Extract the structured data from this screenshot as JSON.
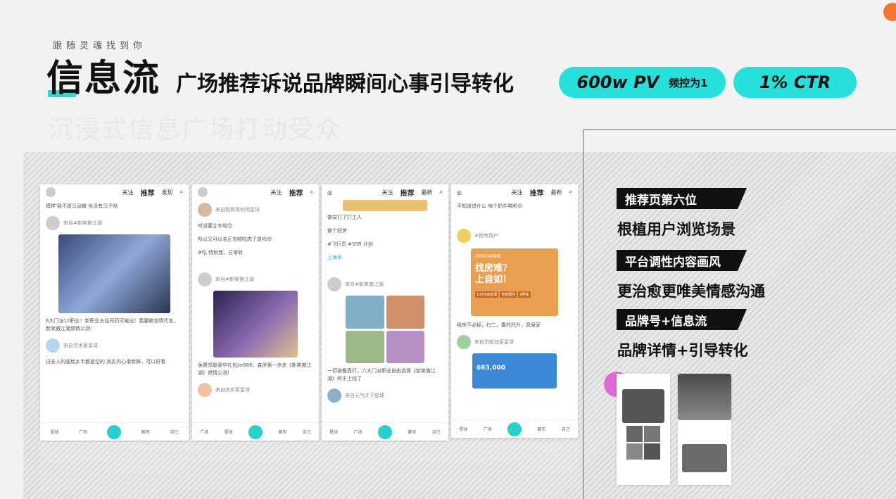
{
  "header": {
    "small_caption": "跟随灵魂找到你",
    "title": "信息流",
    "subtitle": "广场推荐诉说品牌瞬间心事引导转化",
    "ghost_text": "沉浸式信息广场打动受众"
  },
  "pills": {
    "pv_big": "600w PV",
    "pv_small": "频控为1",
    "ctr_big": "1% CTR"
  },
  "phones": {
    "p1": {
      "tabs": [
        "关注",
        "推荐",
        "发现"
      ],
      "post_text_top": "模样'我不是马息瞄 也没有马子陷",
      "author": "来自#新笑傲江湖",
      "caption": "6大门派12职业！新职业五仙司药可输出！我要梳妆情代言，新笑傲江湖燃情公测！",
      "author2": "来自艺术家星球",
      "caption2": "过去人的画格乡半都是空的 其实内心很新鲜，可以好看",
      "nav": [
        "星球",
        "广场",
        "发布瞬间",
        "聊天",
        "自己"
      ]
    },
    "p2": {
      "tabs": [
        "关注",
        "推荐"
      ],
      "author": "来自极致规划师星球",
      "text1": "听说要立冬啦😊",
      "text2": "所以又可以名正言顺吃肉了是吗😊",
      "tags": "#吃 特别我，日常收",
      "author2": "来自#新笑傲江湖",
      "caption": "免费领取豪华礼包jie666，森罗第一步走《新笑傲江湖》燃情公测！",
      "author3": "来自务实家星球",
      "nav": [
        "广场",
        "星球",
        "发布瞬间",
        "聊天",
        "自己"
      ]
    },
    "p3": {
      "tabs": [
        "关注",
        "推荐",
        "最新"
      ],
      "text1": "做安打了打工人",
      "text2": "做个好梦",
      "tags": "#飞行员  #SSR 计划",
      "location": "上海市",
      "author": "来自#新笑傲江湖",
      "caption": "一切装备靠打，六大门派职业自由选择《新笑傲江湖》终于上线了",
      "author2": "来自元气才子星球",
      "nav": [
        "星球",
        "广场",
        "发布瞬间",
        "聊天",
        "自己"
      ]
    },
    "p4": {
      "tabs": [
        "关注",
        "推荐",
        "最新"
      ],
      "text_top": "不知道说什么 啃个奶牛鸭吧😊",
      "author": "#新房用户",
      "ad_title": "找房难？上自如！",
      "ad_brand": "ZIROOM自如",
      "ad_buttons": [
        "100%真房源",
        "管家服务",
        "0押金"
      ],
      "ad_caption": "租房不必掉，扫二，委托托升，真居家",
      "author2": "来自贷款加家星球",
      "money": "683,000",
      "nav": [
        "星球",
        "广场",
        "发布瞬间",
        "聊天",
        "自己"
      ]
    }
  },
  "right_panel": {
    "tag1": "推荐页第六位",
    "line1": "根植用户浏览场景",
    "tag2": "平台调性内容画风",
    "line2": "更治愈更唯美情感沟通",
    "tag3": "品牌号+信息流",
    "line3": "品牌详情+引导转化"
  },
  "colors": {
    "accent": "#26e0dc",
    "brand_orange": "#f07830"
  }
}
